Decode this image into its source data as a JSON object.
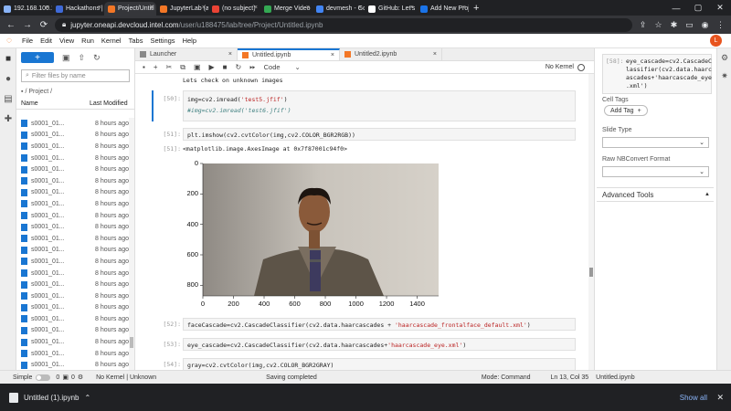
{
  "browser": {
    "tabs": [
      {
        "label": "192.168.100.1",
        "fav": "#8ab4f8"
      },
      {
        "label": "Hackathons |",
        "fav": "#3f6ad8"
      },
      {
        "label": "Project/Untitl",
        "fav": "#f37726",
        "active": true
      },
      {
        "label": "JupyterLab (a",
        "fav": "#f37726"
      },
      {
        "label": "(no subject)",
        "fav": "#ea4335"
      },
      {
        "label": "Merge Video",
        "fav": "#34a853"
      },
      {
        "label": "devmesh - Go",
        "fav": "#4285f4"
      },
      {
        "label": "GitHub: Let's",
        "fav": "#ffffff"
      },
      {
        "label": "Add New Proj",
        "fav": "#1a73e8"
      }
    ],
    "url_host": "jupyter.oneapi.devcloud.intel.com",
    "url_path": "/user/u188475/lab/tree/Project/Untitled.ipynb"
  },
  "menu": [
    "File",
    "Edit",
    "View",
    "Run",
    "Kernel",
    "Tabs",
    "Settings",
    "Help"
  ],
  "user_initial": "L",
  "filebrowser": {
    "new_label": "+",
    "filter_placeholder": "Filter files by name",
    "breadcrumb": "/ Project /",
    "col_name": "Name",
    "col_modified": "Last Modified",
    "files": [
      {
        "name": "s0001_01...",
        "modified": "8 hours ago"
      },
      {
        "name": "s0001_01...",
        "modified": "8 hours ago"
      },
      {
        "name": "s0001_01...",
        "modified": "8 hours ago"
      },
      {
        "name": "s0001_01...",
        "modified": "8 hours ago"
      },
      {
        "name": "s0001_01...",
        "modified": "8 hours ago"
      },
      {
        "name": "s0001_01...",
        "modified": "8 hours ago"
      },
      {
        "name": "s0001_01...",
        "modified": "8 hours ago"
      },
      {
        "name": "s0001_01...",
        "modified": "8 hours ago"
      },
      {
        "name": "s0001_01...",
        "modified": "8 hours ago"
      },
      {
        "name": "s0001_01...",
        "modified": "8 hours ago"
      },
      {
        "name": "s0001_01...",
        "modified": "8 hours ago"
      },
      {
        "name": "s0001_01...",
        "modified": "8 hours ago"
      },
      {
        "name": "s0001_01...",
        "modified": "8 hours ago"
      },
      {
        "name": "s0001_01...",
        "modified": "8 hours ago"
      },
      {
        "name": "s0001_01...",
        "modified": "8 hours ago"
      },
      {
        "name": "s0001_01...",
        "modified": "8 hours ago"
      },
      {
        "name": "s0001_01...",
        "modified": "8 hours ago"
      },
      {
        "name": "s0001_01...",
        "modified": "8 hours ago"
      },
      {
        "name": "s0001_01...",
        "modified": "8 hours ago"
      },
      {
        "name": "s0001_01...",
        "modified": "8 hours ago"
      },
      {
        "name": "s0001_01...",
        "modified": "8 hours ago"
      },
      {
        "name": "s0001_01...",
        "modified": "8 hours ago"
      },
      {
        "name": "s0001_01...",
        "modified": "8 hours ago"
      }
    ]
  },
  "doctabs": [
    {
      "label": "Launcher",
      "icon": "launcher"
    },
    {
      "label": "Untitled.ipynb",
      "icon": "notebook",
      "active": true
    },
    {
      "label": "Untitled2.ipynb",
      "icon": "notebook"
    }
  ],
  "nbtoolbar": {
    "cell_type": "Code",
    "kernel": "No Kernel"
  },
  "cells": {
    "md_text": "Lets check on unknown images",
    "c50_prompt": "[50]:",
    "c50_line1_a": "img=cv2.imread(",
    "c50_line1_s": "'test5.jfif'",
    "c50_line1_b": ")",
    "c50_line2": "#img=cv2.imread('test6.jfif')",
    "c51_prompt": "[51]:",
    "c51_code": "plt.imshow(cv2.cvtColor(img,cv2.COLOR_BGR2RGB))",
    "c51_out_prompt": "[51]:",
    "c51_out": "<matplotlib.image.AxesImage at 0x7f87001c94f0>",
    "c52_prompt": "[52]:",
    "c52_a": "faceCascade=cv2.CascadeClassifier(cv2.data.haarcascades + ",
    "c52_s": "'haarcascade_frontalface_default.xml'",
    "c52_b": ")",
    "c53_prompt": "[53]:",
    "c53_a": "eye_cascade=cv2.CascadeClassifier(cv2.data.haarcascades+",
    "c53_s": "'haarcascade_eye.xml'",
    "c53_b": ")",
    "c54_prompt": "[54]:",
    "c54_code": "gray=cv2.cvtColor(img,cv2.COLOR_BGR2GRAY)"
  },
  "plot": {
    "xticks": [
      "0",
      "200",
      "400",
      "600",
      "800",
      "1000",
      "1200",
      "1400"
    ],
    "yticks": [
      "0",
      "200",
      "400",
      "600",
      "800"
    ]
  },
  "inspector": {
    "prompt": "[58]:",
    "code_lines": [
      "eye_cascade=cv2.CascadeC",
      "lassifier(cv2.data.haarc",
      "ascades+'haarcascade_eye",
      ".xml')"
    ],
    "cell_tags": "Cell Tags",
    "add_tag": "Add Tag",
    "slide_type": "Slide Type",
    "raw_nbconvert": "Raw NBConvert Format",
    "advanced_tools": "Advanced Tools"
  },
  "status": {
    "mode_label": "Simple",
    "num1": "0",
    "num2": "0",
    "kernel": "No Kernel | Unknown",
    "saving": "Saving completed",
    "mode": "Mode: Command",
    "position": "Ln 13, Col 35",
    "filename": "Untitled.ipynb"
  },
  "downloads": {
    "file": "Untitled (1).ipynb",
    "show_all": "Show all"
  }
}
